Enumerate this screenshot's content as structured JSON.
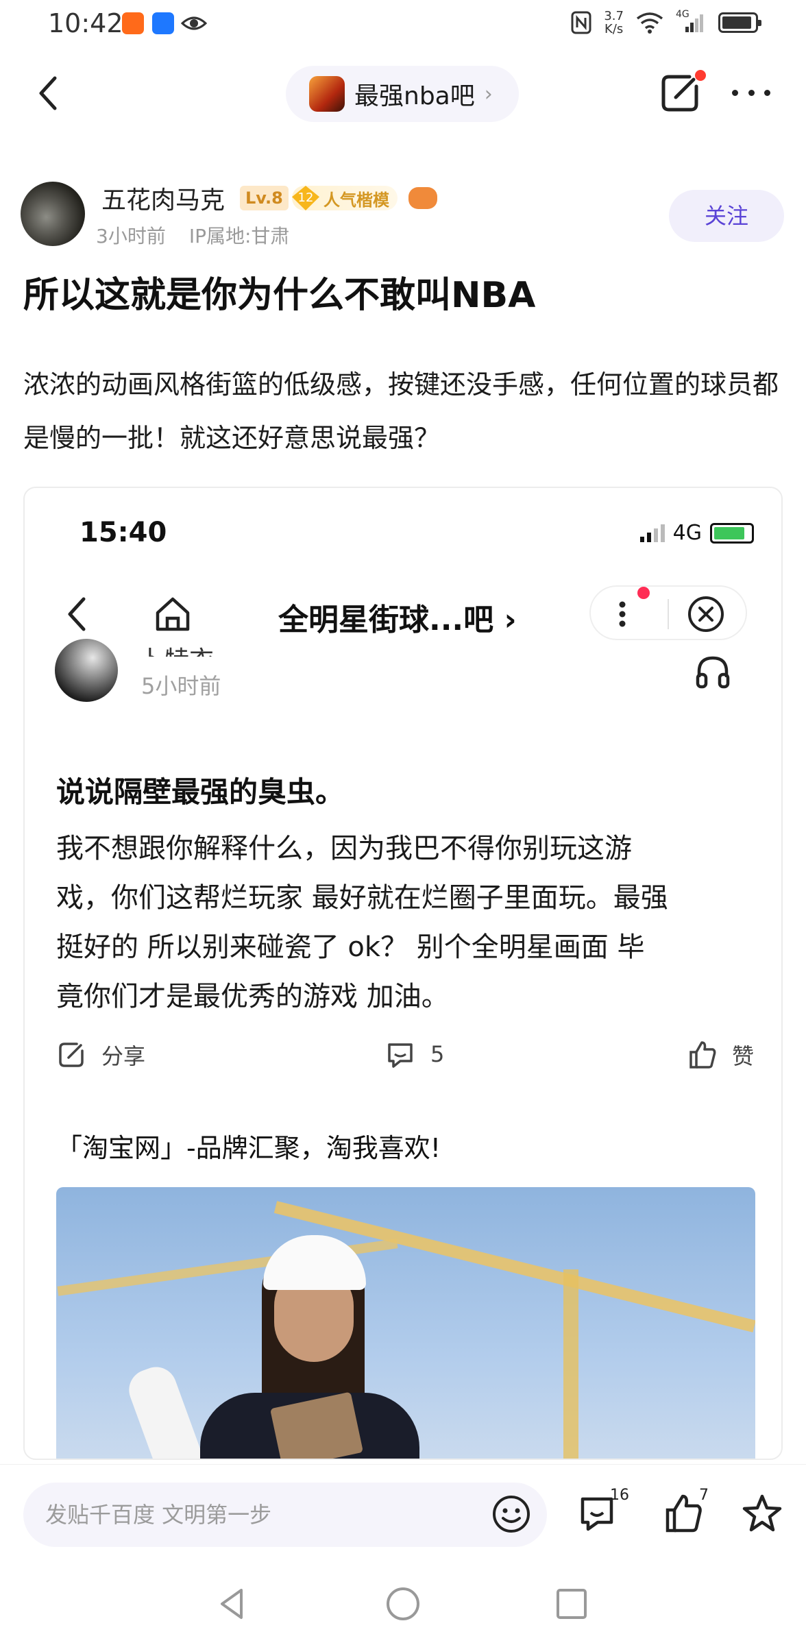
{
  "status_bar": {
    "time": "10:42",
    "net_speed_value": "3.7",
    "net_speed_unit": "K/s",
    "network": "4G"
  },
  "nav": {
    "forum_name": "最强nba吧",
    "forum_chevron": "›"
  },
  "post": {
    "author": "五花肉马克",
    "level": "Lv.8",
    "badge_number": "12",
    "badge_text": "人气楷模",
    "time": "3小时前",
    "ip": "IP属地:甘肃",
    "follow_label": "关注",
    "title": "所以这就是你为什么不敢叫NBA",
    "body": "浓浓的动画风格街篮的低级感，按键还没手感，任何位置的球员都是慢的一批！就这还好意思说最强？"
  },
  "embedded": {
    "time": "15:40",
    "network": "4G",
    "nav_title": "全明星街球...吧",
    "nav_chevron": "›",
    "author_partial": "卜特衣",
    "post_time": "5小时前",
    "post_title": "说说隔壁最强的臭虫。",
    "post_body_lines": [
      "我不想跟你解释什么，因为我巴不得你别玩这游",
      "戏，你们这帮烂玩家 最好就在烂圈子里面玩。最强",
      "挺好的 所以别来碰瓷了 ok？ 别个全明星画面 毕",
      "竟你们才是最优秀的游戏 加油。"
    ],
    "share_label": "分享",
    "comment_count": "5",
    "like_label": "赞",
    "ad_text": "「淘宝网」-品牌汇聚，淘我喜欢!"
  },
  "bottom_bar": {
    "comment_placeholder": "发贴千百度 文明第一步",
    "comments_count": "16",
    "likes_count": "7"
  },
  "colors": {
    "accent": "#5a43d6",
    "badge_gold": "#f7b61c",
    "level_badge_bg": "#fde8c8",
    "red_dot": "#ff3b30",
    "pill_bg": "#f5f4fb"
  },
  "icons": [
    "back-arrow-icon",
    "edit-icon",
    "more-icon",
    "headphones-icon",
    "share-icon",
    "comment-icon",
    "like-icon",
    "emoji-icon",
    "star-icon",
    "home-icon",
    "close-icon"
  ]
}
